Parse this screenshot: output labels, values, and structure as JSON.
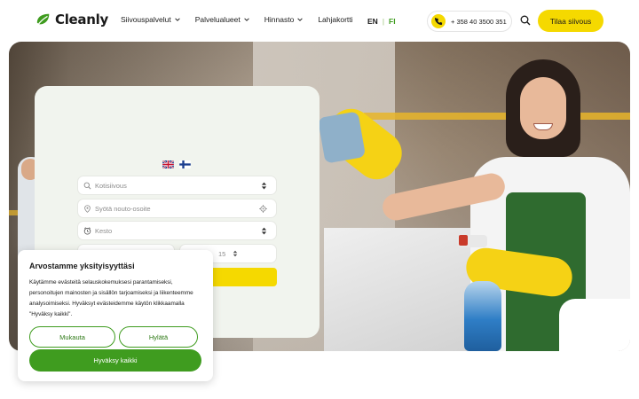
{
  "brand": {
    "name": "Cleanly",
    "accent": "#3f9c1f",
    "highlight": "#f5d900"
  },
  "nav": {
    "items": [
      {
        "label": "Siivouspalvelut",
        "has_dropdown": true
      },
      {
        "label": "Palvelualueet",
        "has_dropdown": true
      },
      {
        "label": "Hinnasto",
        "has_dropdown": true
      },
      {
        "label": "Lahjakortti",
        "has_dropdown": false
      }
    ]
  },
  "language": {
    "en": "EN",
    "separator": "|",
    "fi": "FI",
    "active": "FI"
  },
  "contact": {
    "phone": "+ 358 40 3500 351",
    "icon": "phone-icon"
  },
  "header": {
    "search_icon": "search-icon",
    "cta_label": "Tilaa siivous"
  },
  "booking": {
    "flags": [
      "uk-flag-icon",
      "fi-flag-icon"
    ],
    "service_placeholder": "Kotisiivous",
    "address_placeholder": "Syötä nouto-osoite",
    "duration_placeholder": "Kesto",
    "time_value": "15"
  },
  "cookie": {
    "title": "Arvostamme yksityisyyttäsi",
    "text": "Käytämme evästeitä selauskokemuksesi parantamiseksi, personoitujen mainosten ja sisällön tarjoamiseksi ja liikenteemme analysoimiseksi. Hyväksyt evästeidemme käytön klikkaamalla \"Hyväksy kaikki\".",
    "customize_label": "Mukauta",
    "reject_label": "Hylätä",
    "accept_label": "Hyväksy kaikki"
  }
}
